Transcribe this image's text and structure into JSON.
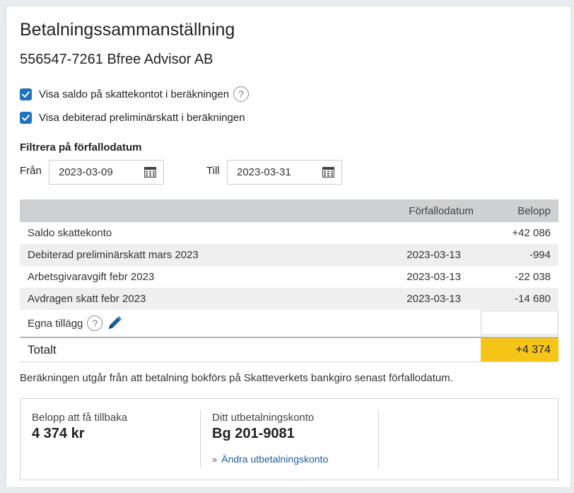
{
  "page": {
    "title": "Betalningssammanställning",
    "company": "556547-7261 Bfree Advisor AB"
  },
  "options": [
    {
      "label": "Visa saldo på skattekontot i beräkningen",
      "checked": true,
      "has_help": true
    },
    {
      "label": "Visa debiterad preliminärskatt i beräkningen",
      "checked": true,
      "has_help": false
    }
  ],
  "filter": {
    "heading": "Filtrera på förfallodatum",
    "from_label": "Från",
    "from_value": "2023-03-09",
    "to_label": "Till",
    "to_value": "2023-03-31"
  },
  "table": {
    "headers": {
      "date": "Förfallodatum",
      "amount": "Belopp"
    },
    "rows": [
      {
        "name": "Saldo skattekonto",
        "date": "",
        "amount": "+42 086"
      },
      {
        "name": "Debiterad preliminärskatt mars 2023",
        "date": "2023-03-13",
        "amount": "-994"
      },
      {
        "name": "Arbetsgivaravgift febr 2023",
        "date": "2023-03-13",
        "amount": "-22 038"
      },
      {
        "name": "Avdragen skatt febr 2023",
        "date": "2023-03-13",
        "amount": "-14 680"
      }
    ],
    "custom_label": "Egna tillägg",
    "custom_value": "",
    "total_label": "Totalt",
    "total_value": "+4 374"
  },
  "note": "Beräkningen utgår från att betalning bokförs på Skatteverkets bankgiro senast förfallodatum.",
  "summary": {
    "refund_label": "Belopp att få tillbaka",
    "refund_value": "4 374 kr",
    "account_label": "Ditt utbetalningskonto",
    "account_value": "Bg 201-9081",
    "change_link": "Ändra utbetalningskonto"
  },
  "colors": {
    "accent": "#1e73be",
    "total_highlight": "#f5c518",
    "link": "#1f5d9c"
  },
  "icons": [
    "checkmark-icon",
    "help-icon",
    "calendar-icon",
    "pencil-icon",
    "chevron-double-right-icon"
  ]
}
